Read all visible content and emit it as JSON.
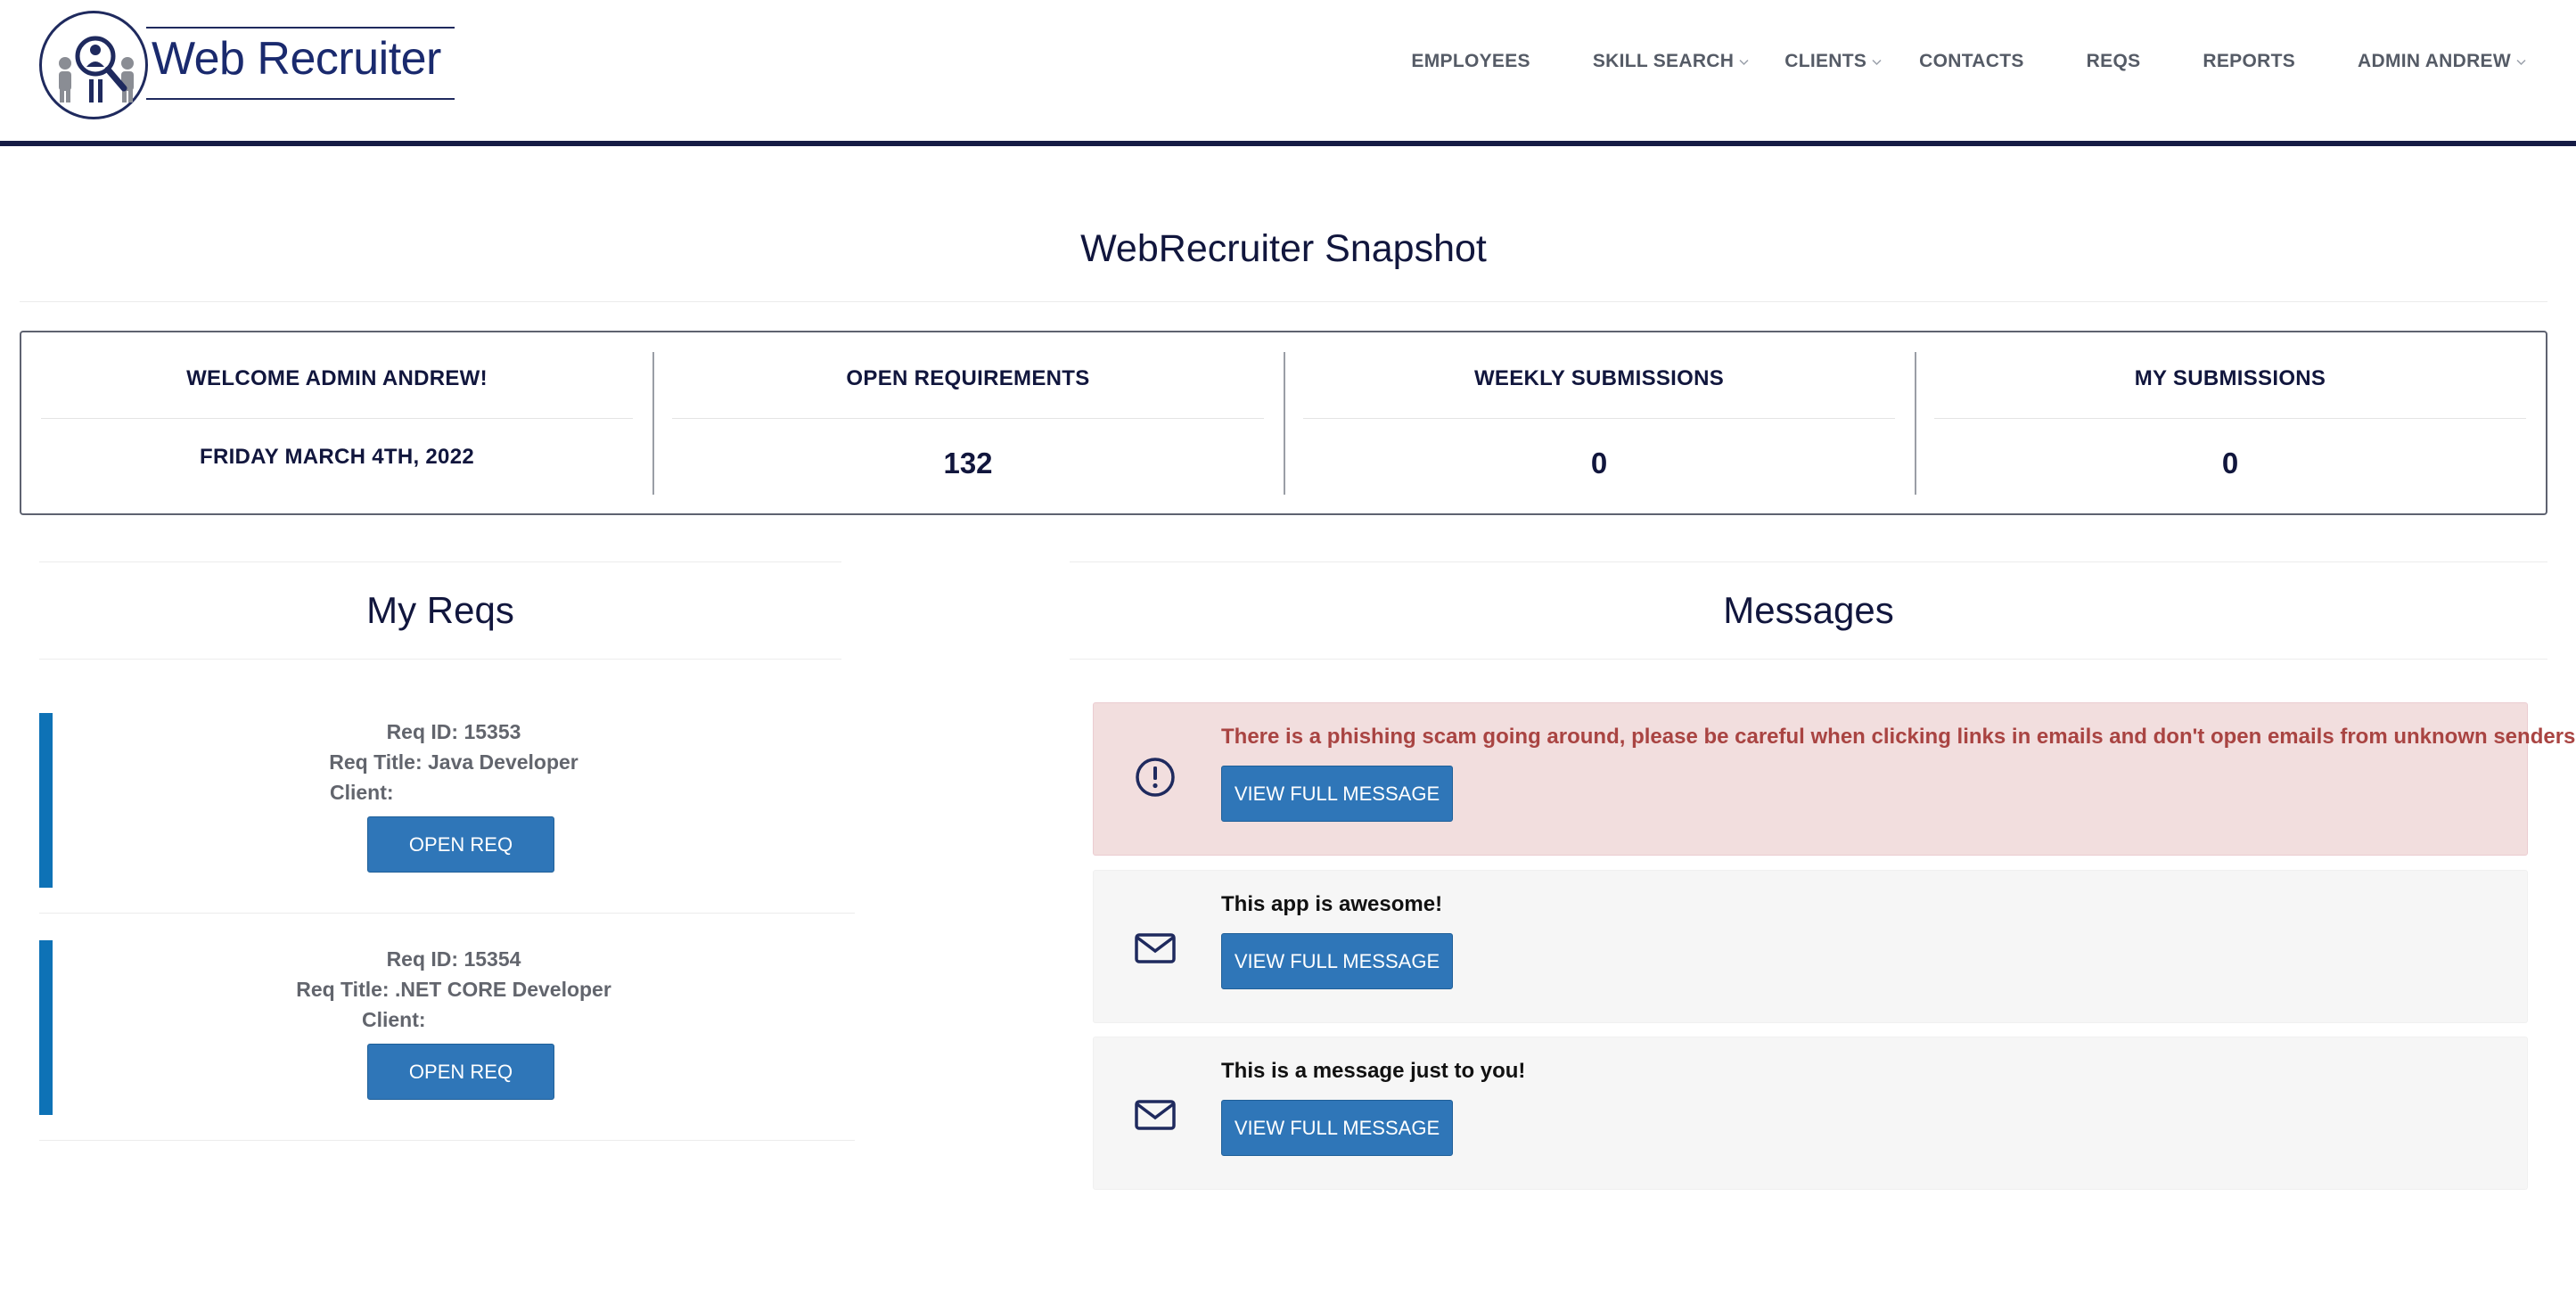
{
  "header": {
    "logo_text": "Web Recruiter",
    "nav": [
      {
        "label": "EMPLOYEES",
        "dropdown": false
      },
      {
        "label": "SKILL SEARCH",
        "dropdown": true
      },
      {
        "label": "CLIENTS",
        "dropdown": true
      },
      {
        "label": "CONTACTS",
        "dropdown": false
      },
      {
        "label": "REQS",
        "dropdown": false
      },
      {
        "label": "REPORTS",
        "dropdown": false
      },
      {
        "label": "ADMIN ANDREW",
        "dropdown": true
      }
    ]
  },
  "page_title": "WebRecruiter Snapshot",
  "snapshot": {
    "welcome": "WELCOME ADMIN ANDREW!",
    "date": "FRIDAY MARCH 4TH, 2022",
    "open_requirements_label": "OPEN REQUIREMENTS",
    "open_requirements_value": "132",
    "weekly_submissions_label": "WEEKLY SUBMISSIONS",
    "weekly_submissions_value": "0",
    "my_submissions_label": "MY SUBMISSIONS",
    "my_submissions_value": "0"
  },
  "my_reqs": {
    "title": "My Reqs",
    "items": [
      {
        "req_id": "Req ID: 15353",
        "req_title": "Req Title: Java Developer",
        "client": "Client:",
        "button": "OPEN REQ"
      },
      {
        "req_id": "Req ID: 15354",
        "req_title": "Req Title: .NET CORE Developer",
        "client": "Client:",
        "button": "OPEN REQ"
      }
    ]
  },
  "messages": {
    "title": "Messages",
    "items": [
      {
        "type": "alert",
        "icon": "exclamation-circle-icon",
        "text": "There is a phishing scam going around, please be careful when clicking links in emails and don't open emails from unknown senders!",
        "button": "VIEW FULL MESSAGE"
      },
      {
        "type": "plain",
        "icon": "envelope-icon",
        "text": "This app is awesome!",
        "button": "VIEW FULL MESSAGE"
      },
      {
        "type": "plain",
        "icon": "envelope-icon",
        "text": "This is a message just to you!",
        "button": "VIEW FULL MESSAGE"
      }
    ]
  },
  "colors": {
    "brand_navy": "#161c45",
    "button_blue": "#2f76b8",
    "req_accent": "#0e72b6",
    "alert_bg": "#f2dede",
    "alert_text": "#a94442"
  }
}
